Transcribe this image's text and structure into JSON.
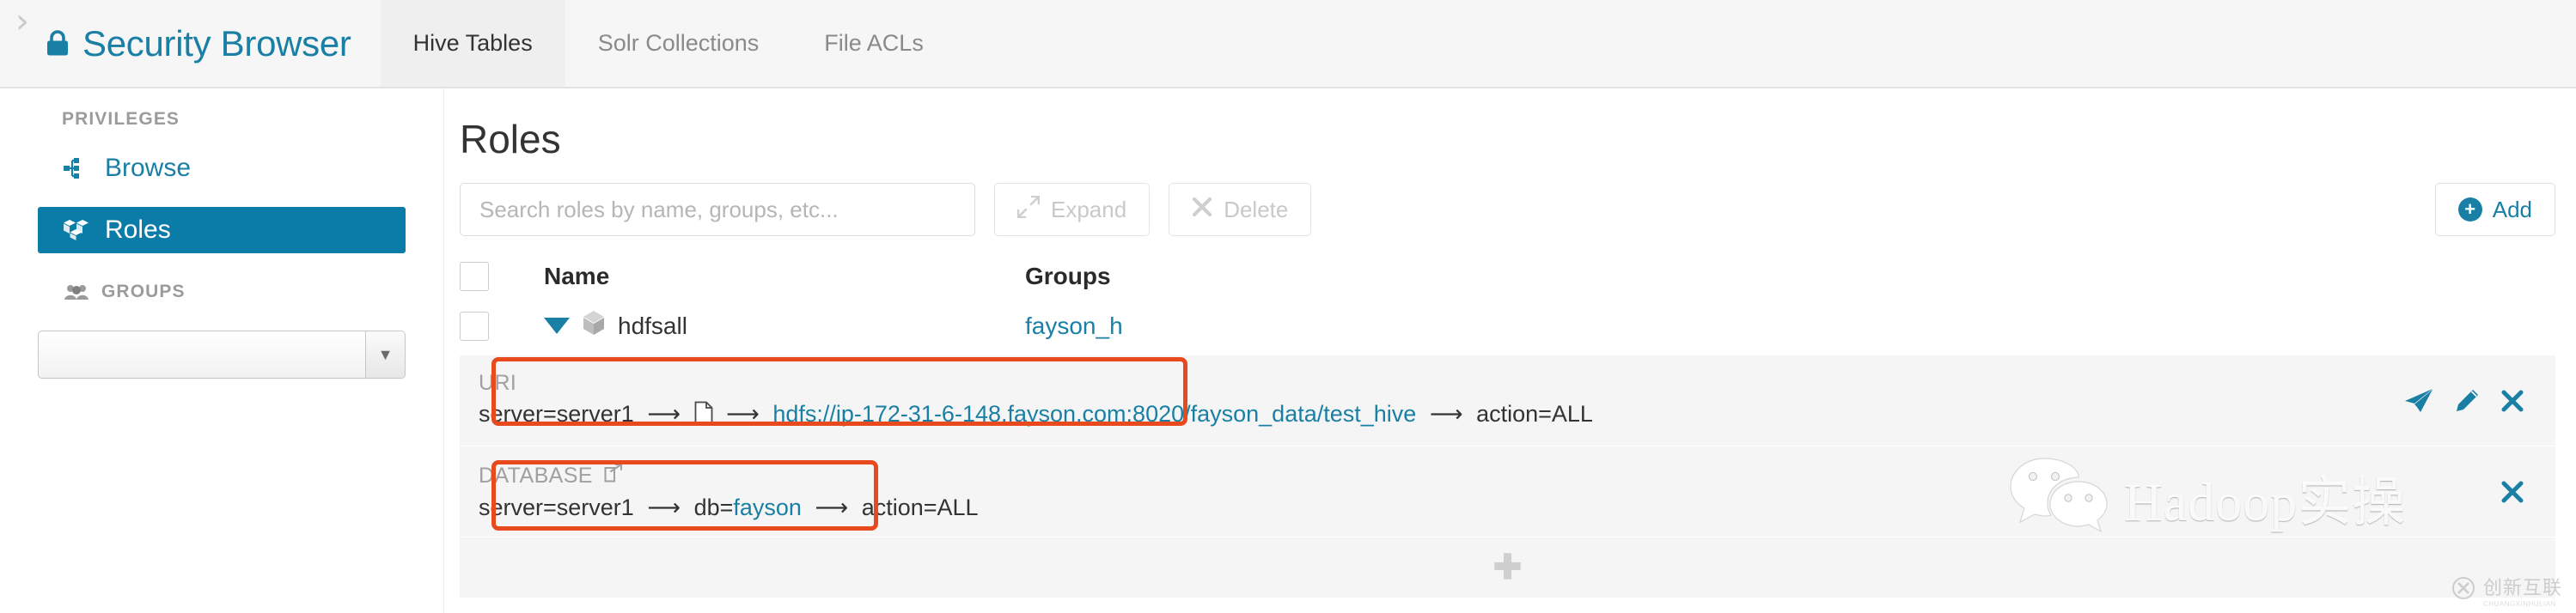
{
  "topbar": {
    "toggle_icon": "chevron-right-icon",
    "brand_icon": "lock-icon",
    "brand_title": "Security Browser",
    "tabs": [
      {
        "label": "Hive Tables",
        "active": true
      },
      {
        "label": "Solr Collections",
        "active": false
      },
      {
        "label": "File ACLs",
        "active": false
      }
    ]
  },
  "sidebar": {
    "privileges_heading": "PRIVILEGES",
    "items": [
      {
        "label": "Browse",
        "icon": "sitemap-icon",
        "active": false
      },
      {
        "label": "Roles",
        "icon": "cubes-icon",
        "active": true
      }
    ],
    "groups_heading": "GROUPS",
    "groups_icon": "users-icon",
    "groups_select_value": "",
    "groups_select_arrow_icon": "caret-down-icon"
  },
  "main": {
    "page_title": "Roles",
    "search": {
      "placeholder": "Search roles by name, groups, etc...",
      "value": ""
    },
    "buttons": {
      "expand_label": "Expand",
      "expand_icon": "expand-arrows-icon",
      "delete_label": "Delete",
      "delete_icon": "times-icon",
      "add_label": "Add",
      "add_icon": "plus-circle-icon"
    },
    "table": {
      "headers": {
        "checkbox": "select-all",
        "name": "Name",
        "groups": "Groups"
      },
      "rows": [
        {
          "expand_icon": "caret-down-icon",
          "role_icon": "cube-icon",
          "name": "hdfsall",
          "groups": "fayson_h"
        }
      ]
    },
    "privileges": [
      {
        "kind": "URI",
        "kind_icon": "",
        "highlighted": true,
        "parts": [
          {
            "text": "server=server1",
            "type": "plain"
          },
          {
            "text": "→",
            "type": "arrow"
          },
          {
            "text": "file-icon",
            "type": "icon"
          },
          {
            "text": "→",
            "type": "arrow"
          },
          {
            "text": "hdfs://ip-172-31-6-148.fayson.com:8020/fayson_data/test_hive",
            "type": "link"
          },
          {
            "text": "→",
            "type": "arrow"
          },
          {
            "text": "action=ALL",
            "type": "plain"
          }
        ],
        "actions": [
          {
            "icon": "paper-plane-icon",
            "name": "send-privilege-button"
          },
          {
            "icon": "pencil-icon",
            "name": "edit-privilege-button"
          },
          {
            "icon": "times-icon",
            "name": "remove-privilege-button"
          }
        ]
      },
      {
        "kind": "DATABASE",
        "kind_icon": "external-link-icon",
        "highlighted": true,
        "parts": [
          {
            "text": "server=server1",
            "type": "plain"
          },
          {
            "text": "→",
            "type": "arrow"
          },
          {
            "text": "db=",
            "type": "plain"
          },
          {
            "text": "fayson",
            "type": "link"
          },
          {
            "text": "→",
            "type": "arrow"
          },
          {
            "text": "action=ALL",
            "type": "plain"
          }
        ],
        "actions": [
          {
            "icon": "times-icon",
            "name": "remove-privilege-button"
          }
        ]
      }
    ],
    "add_privilege_row": {
      "icon": "plus-icon"
    }
  },
  "watermarks": {
    "wechat_text": "Hadoop实操",
    "wechat_icon": "wechat-icon",
    "corner_cn": "创新互联",
    "corner_py": "CHUANGXINHULIAN",
    "corner_icon": "cx-logo-icon"
  },
  "colors": {
    "brand": "#1a7fa5",
    "sidebar_active": "#0b7ba8",
    "highlight": "#e8491d",
    "topbar_bg": "#f6f6f6",
    "priv_bg": "#f5f5f5"
  }
}
